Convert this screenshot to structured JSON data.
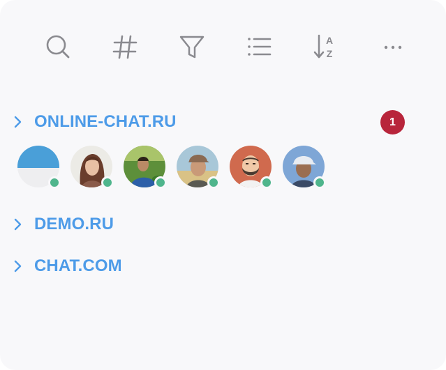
{
  "toolbar": {
    "buttons": [
      {
        "icon": "search-icon"
      },
      {
        "icon": "hashtag-icon"
      },
      {
        "icon": "filter-icon"
      },
      {
        "icon": "list-icon"
      },
      {
        "icon": "sort-az-icon",
        "letters": [
          "A",
          "Z"
        ]
      },
      {
        "icon": "more-dots-icon"
      }
    ]
  },
  "groups": [
    {
      "name": "ONLINE-CHAT.RU",
      "badge": "1",
      "expanded": true,
      "members": [
        {
          "status": "online"
        },
        {
          "status": "online"
        },
        {
          "status": "online"
        },
        {
          "status": "online"
        },
        {
          "status": "online"
        },
        {
          "status": "online"
        }
      ]
    },
    {
      "name": "DEMO.RU",
      "expanded": false
    },
    {
      "name": "CHAT.COM",
      "expanded": false
    }
  ],
  "colors": {
    "accent": "#4d9be8",
    "badge": "#b8253b",
    "online": "#4fb58c",
    "icon": "#8a8a8f",
    "background": "#f8f8fa"
  }
}
